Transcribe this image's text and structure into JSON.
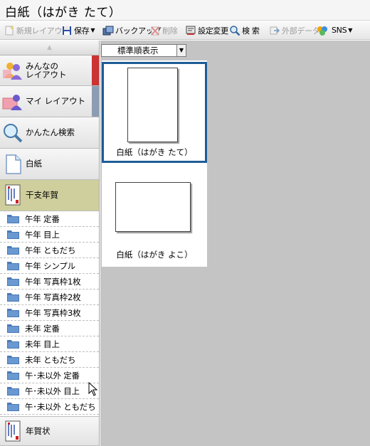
{
  "window": {
    "title": "白紙（はがき たて）"
  },
  "toolbar": {
    "new_layout": "新規レイアウト",
    "save": "保存",
    "backup": "バックアップ",
    "delete": "削除",
    "settings": "設定変更",
    "search": "検 索",
    "external_data": "外部データ",
    "sns": "SNS"
  },
  "sidebar": {
    "categories": [
      {
        "label_line1": "みんなの",
        "label_line2": "レイアウト",
        "strip_color": "#cc3333"
      },
      {
        "label": "マイ レイアウト",
        "strip_color": "#8c9db3"
      },
      {
        "label": "かんたん検索"
      },
      {
        "label": "白紙"
      },
      {
        "label": "干支年賀"
      }
    ],
    "sub_items": [
      "午年 定番",
      "午年 目上",
      "午年 ともだち",
      "午年 シンプル",
      "午年 写真枠1枚",
      "午年 写真枠2枚",
      "午年 写真枠3枚",
      "未年 定番",
      "未年 目上",
      "未年 ともだち",
      "午･未以外 定番",
      "午･未以外 目上",
      "午･未以外 ともだち"
    ],
    "bottom_category": {
      "label": "年賀状"
    }
  },
  "main": {
    "sort_label": "標準順表示",
    "templates": [
      {
        "caption": "白紙（はがき たて）"
      },
      {
        "caption": "白紙（はがき よこ）"
      }
    ]
  }
}
